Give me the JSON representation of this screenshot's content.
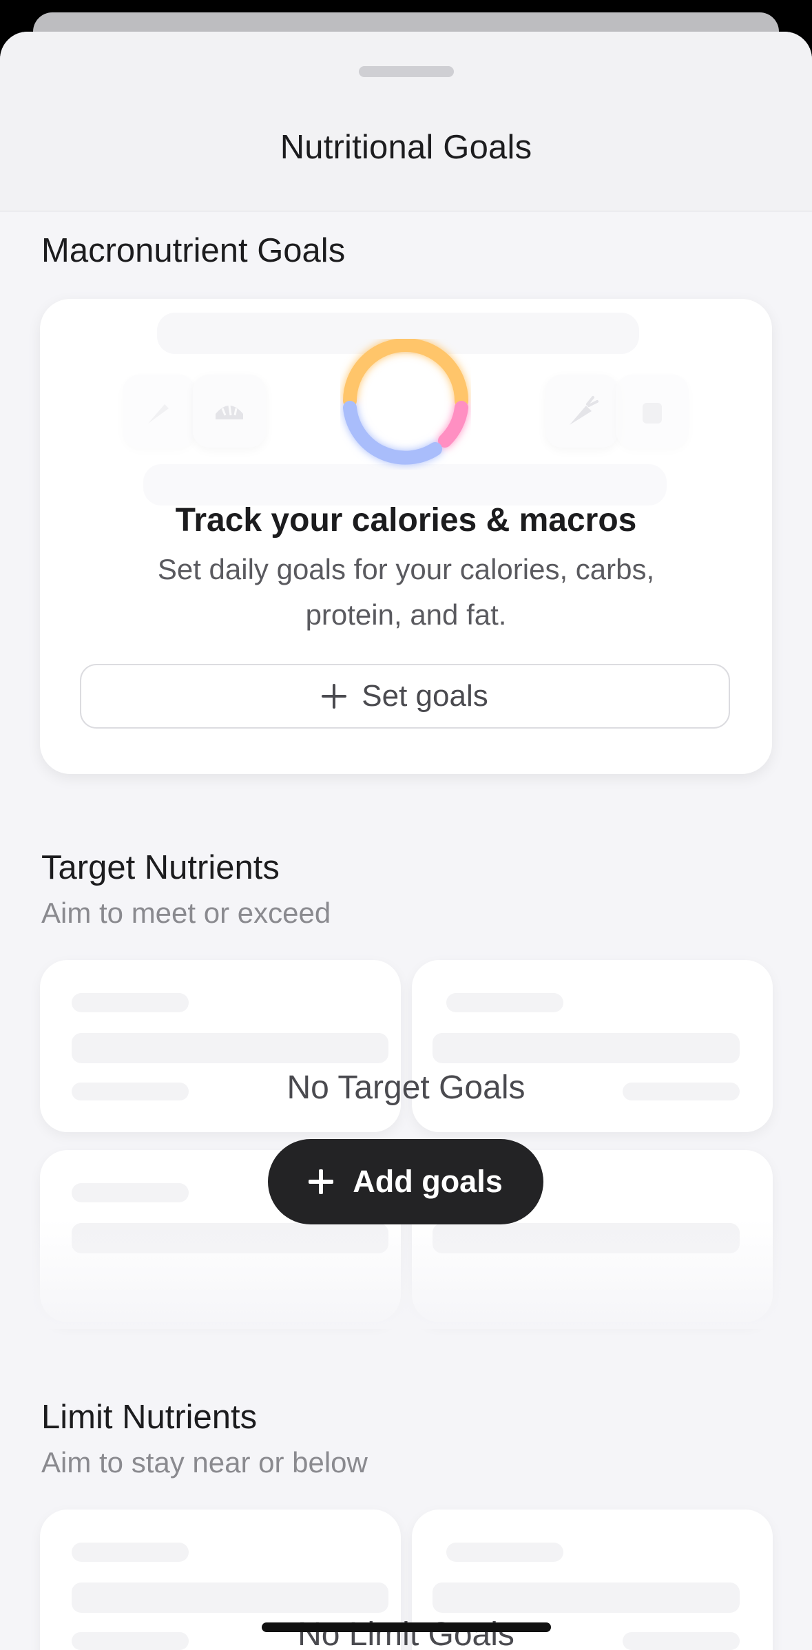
{
  "nav": {
    "title": "Nutritional Goals"
  },
  "macro": {
    "section_title": "Macronutrient Goals",
    "promo_title": "Track your calories & macros",
    "promo_text": "Set daily goals for your calories, carbs, protein, and fat.",
    "button_label": "Set goals",
    "ring_colors": {
      "carbs": "#ffc56a",
      "protein": "#a9bdfb",
      "fat": "#ff8fc2"
    }
  },
  "target": {
    "section_title": "Target Nutrients",
    "subtitle": "Aim to meet or exceed",
    "empty_label": "No Target Goals",
    "button_label": "Add goals"
  },
  "limit": {
    "section_title": "Limit Nutrients",
    "subtitle": "Aim to stay near or below",
    "empty_label": "No Limit Goals"
  }
}
